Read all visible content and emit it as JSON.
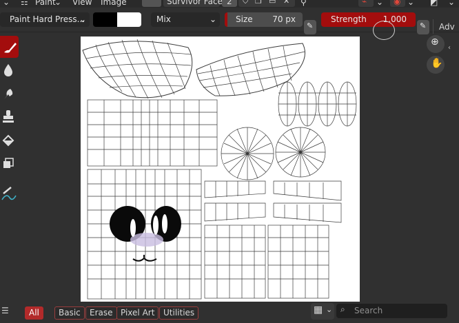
{
  "header": {
    "editor_menu": "Paint",
    "menus": [
      "View",
      "Image"
    ],
    "image_name": "Survivor Face",
    "users_count": "2"
  },
  "toolbar": {
    "brush_name": "Paint Hard Press...",
    "blend_mode": "Mix",
    "size_label": "Size",
    "size_value": "70 px",
    "strength_label": "Strength",
    "strength_value": "1.000",
    "adv_label": "Adv",
    "primary_color": "#000000",
    "secondary_color": "#ffffff",
    "accent_color": "#a30d0d"
  },
  "left_tools": [
    {
      "name": "draw",
      "icon": "brush-icon",
      "active": true
    },
    {
      "name": "soften",
      "icon": "drop-icon",
      "active": false
    },
    {
      "name": "smear",
      "icon": "smear-icon",
      "active": false
    },
    {
      "name": "clone",
      "icon": "stamp-icon",
      "active": false
    },
    {
      "name": "fill",
      "icon": "bucket-icon",
      "active": false
    },
    {
      "name": "mask",
      "icon": "mask-icon",
      "active": false
    },
    {
      "name": "annotate",
      "icon": "annotate-icon",
      "active": false
    }
  ],
  "nav": {
    "zoom_icon": "zoom-icon",
    "pan_icon": "hand-icon"
  },
  "asset_shelf": {
    "tabs": [
      "All",
      "Basic",
      "Erase",
      "Pixel Art",
      "Utilities"
    ],
    "active_tab": "All",
    "search_placeholder": "Search"
  }
}
